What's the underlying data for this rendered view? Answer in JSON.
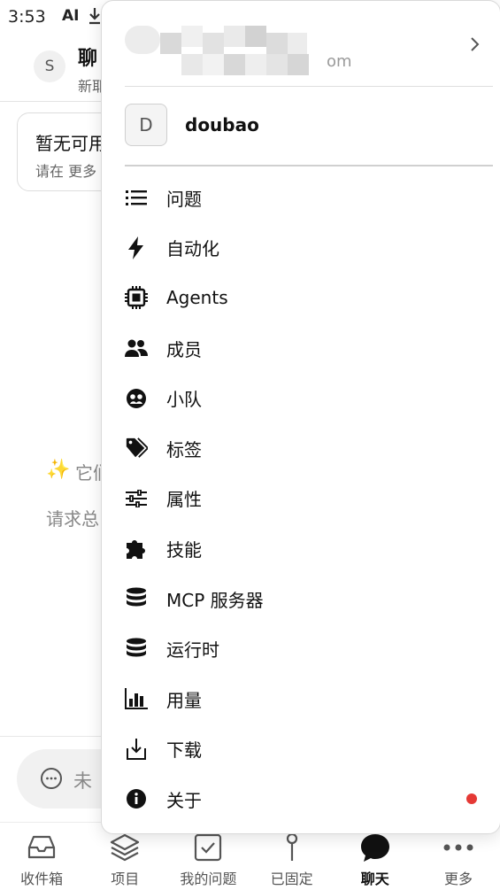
{
  "status_bar": {
    "time": "3:53",
    "ai_label": "AI"
  },
  "background": {
    "avatar_letter": "S",
    "title": "聊",
    "subtitle": "新耶",
    "card_title": "暂无可用",
    "card_subtitle": "请在 更多",
    "hint_line1": "它们",
    "hint_line2": "请求总",
    "input_placeholder": "未"
  },
  "menu": {
    "account_domain_suffix": "om",
    "workspace_letter": "D",
    "workspace_name": "doubao",
    "items": [
      {
        "label": "问题",
        "icon": "list-icon"
      },
      {
        "label": "自动化",
        "icon": "lightning-icon"
      },
      {
        "label": "Agents",
        "icon": "chip-icon"
      },
      {
        "label": "成员",
        "icon": "people-icon"
      },
      {
        "label": "小队",
        "icon": "team-icon"
      },
      {
        "label": "标签",
        "icon": "tag-icon"
      },
      {
        "label": "属性",
        "icon": "sliders-icon"
      },
      {
        "label": "技能",
        "icon": "puzzle-icon"
      },
      {
        "label": "MCP 服务器",
        "icon": "database-icon"
      },
      {
        "label": "运行时",
        "icon": "database-icon"
      },
      {
        "label": "用量",
        "icon": "bar-chart-icon"
      },
      {
        "label": "下载",
        "icon": "download-icon"
      },
      {
        "label": "关于",
        "icon": "info-icon",
        "badge": true
      }
    ]
  },
  "bottom_nav": [
    {
      "label": "收件箱",
      "icon": "inbox-icon"
    },
    {
      "label": "项目",
      "icon": "layers-icon"
    },
    {
      "label": "我的问题",
      "icon": "checkbox-icon"
    },
    {
      "label": "已固定",
      "icon": "pin-icon"
    },
    {
      "label": "聊天",
      "icon": "chat-icon",
      "active": true
    },
    {
      "label": "更多",
      "icon": "more-icon"
    }
  ],
  "colors": {
    "badge": "#e53935",
    "sparkle": "#e8c22d"
  }
}
